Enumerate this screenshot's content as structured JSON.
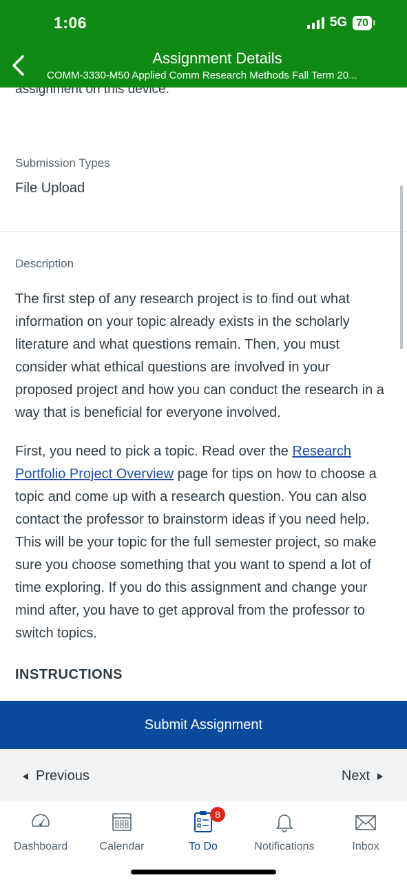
{
  "status_bar": {
    "time": "1:06",
    "network": "5G",
    "battery": "70"
  },
  "header": {
    "title": "Assignment Details",
    "subtitle": "COMM-3330-M50 Applied Comm Research Methods Fall Term 20..."
  },
  "content": {
    "cut_text": "assignment on this device.",
    "submission_types_label": "Submission Types",
    "submission_types_value": "File Upload",
    "description_label": "Description",
    "paragraph1": "The first step of any research project is to find out what information on your topic already exists in the scholarly literature and what questions remain. Then, you must consider what ethical questions are involved in your proposed project and how you can conduct the research in a way that is beneficial for everyone involved.",
    "paragraph2_before_link": "First, you need to pick a topic. Read over the ",
    "paragraph2_link": "Research Portfolio Project Overview",
    "paragraph2_after_link": " page for tips on how to choose a topic and come up with a research question. You can also contact the professor to brainstorm ideas if you need help. This will be your topic for the full semester project, so make sure you choose something that you want to spend a lot of time exploring. If you do this assignment and change your mind after, you have to get approval from the professor to switch topics.",
    "instructions_heading": "INSTRUCTIONS"
  },
  "actions": {
    "submit": "Submit Assignment",
    "previous": "Previous",
    "next": "Next"
  },
  "tabbar": {
    "dashboard": "Dashboard",
    "calendar": "Calendar",
    "todo": "To Do",
    "todo_badge": "8",
    "notifications": "Notifications",
    "inbox": "Inbox"
  },
  "colors": {
    "status_green": "#0e8a14",
    "submit_blue": "#0a4a9c",
    "link_blue": "#1d4fa8",
    "badge_red": "#e0251b"
  }
}
